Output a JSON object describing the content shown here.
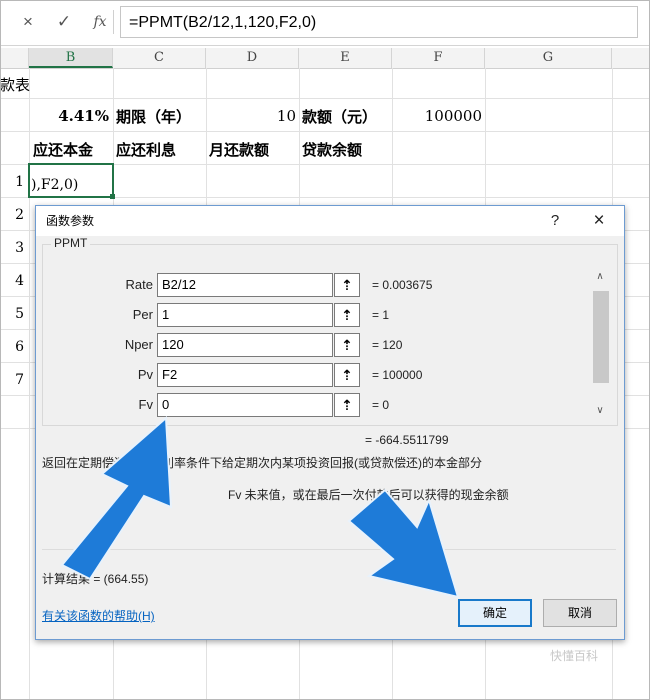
{
  "formula_bar": {
    "cancel_icon": "×",
    "enter_icon": "✓",
    "fx_icon": "fx",
    "formula": "=PPMT(B2/12,1,120,F2,0)"
  },
  "columns": [
    "B",
    "C",
    "D",
    "E",
    "F",
    "G"
  ],
  "sheet": {
    "title_fragment": "款表",
    "rate_value": "4.41%",
    "term_label": "期限（年）",
    "term_value": "10",
    "amount_label": "款额（元）",
    "amount_value": "100000",
    "headers": [
      "应还本金",
      "应还利息",
      "月还款额",
      "贷款余额"
    ],
    "active_cell_text": "),F2,0)",
    "row_numbers": [
      "1",
      "2",
      "3",
      "4",
      "5",
      "6",
      "7"
    ]
  },
  "dialog": {
    "title": "函数参数",
    "help_icon": "?",
    "close_icon": "×",
    "function_name": "PPMT",
    "args": [
      {
        "name": "Rate",
        "value": "B2/12",
        "result": "=  0.003675"
      },
      {
        "name": "Per",
        "value": "1",
        "result": "=  1"
      },
      {
        "name": "Nper",
        "value": "120",
        "result": "=  120"
      },
      {
        "name": "Pv",
        "value": "F2",
        "result": "=  100000"
      },
      {
        "name": "Fv",
        "value": "0",
        "result": "=  0"
      }
    ],
    "collapse_icon": "⇡",
    "scroll_up_icon": "∧",
    "scroll_down_icon": "∨",
    "total_result": "=  -664.5511799",
    "description": "返回在定期偿还、固定利率条件下给定期次内某项投资回报(或贷款偿还)的本金部分",
    "arg_help": "Fv  未来值，或在最后一次付款后可以获得的现金余额",
    "calc_result": "计算结果 =   (664.55)",
    "help_link": "有关该函数的帮助(H)",
    "ok": "确定",
    "cancel": "取消"
  },
  "watermark": "快懂百科",
  "colors": {
    "arrow": "#1e7bd8",
    "grid": "#e1e1e1",
    "link": "#0563c1",
    "ok_border": "#1979ca"
  }
}
